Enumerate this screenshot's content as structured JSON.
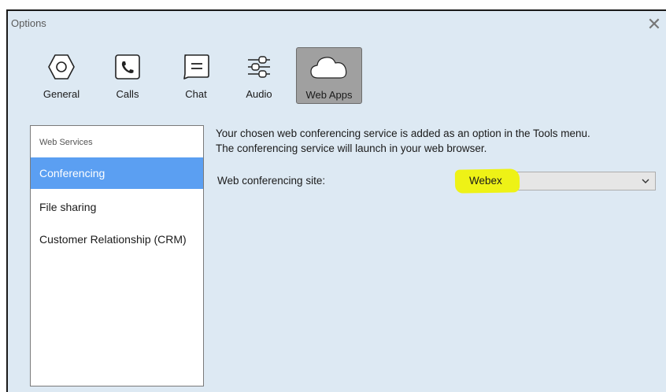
{
  "window": {
    "title": "Options"
  },
  "toolbar": {
    "items": [
      {
        "label": "General",
        "icon": "gear-icon"
      },
      {
        "label": "Calls",
        "icon": "phone-icon"
      },
      {
        "label": "Chat",
        "icon": "chat-bubble-icon"
      },
      {
        "label": "Audio",
        "icon": "sliders-icon"
      },
      {
        "label": "Web Apps",
        "icon": "cloud-icon",
        "active": true
      }
    ]
  },
  "sidebar": {
    "header": "Web Services",
    "items": [
      {
        "label": "Conferencing",
        "selected": true
      },
      {
        "label": "File sharing"
      },
      {
        "label": "Customer Relationship (CRM)"
      }
    ]
  },
  "main": {
    "description_line1": "Your chosen web conferencing service is added as an option in the Tools menu.",
    "description_line2": "The conferencing service will launch in your web browser.",
    "site_label": "Web conferencing site:",
    "site_value": "Webex"
  },
  "colors": {
    "background": "#dde9f3",
    "selected_item": "#5b9ff2",
    "active_tab": "#a0a0a0",
    "highlight": "#eef216"
  }
}
